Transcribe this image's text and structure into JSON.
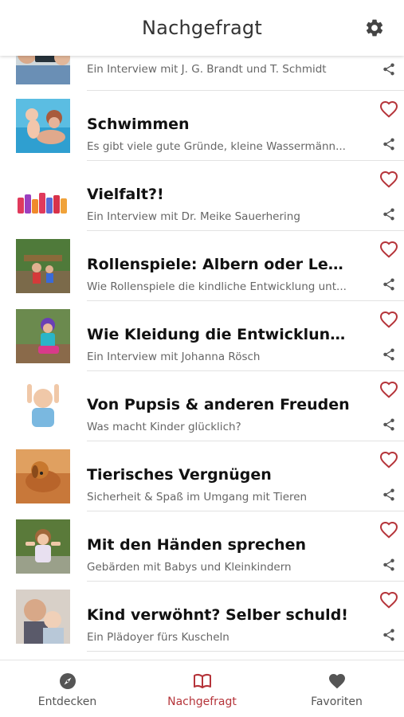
{
  "header": {
    "title": "Nachgefragt",
    "settings_icon": "gear-icon"
  },
  "colors": {
    "accent": "#b5343a",
    "icon_gray": "#555555"
  },
  "items": [
    {
      "title": "",
      "subtitle": "Ein Interview mit J. G. Brandt und T. Schmidt",
      "thumb": "reading-family"
    },
    {
      "title": "Schwimmen",
      "subtitle": "Es gibt viele gute Gründe, kleine Wassermänn...",
      "thumb": "swimming"
    },
    {
      "title": "Vielfalt?!",
      "subtitle": "Ein Interview mit Dr. Meike Sauerhering",
      "thumb": "colorful-figures"
    },
    {
      "title": "Rollenspiele: Albern oder Lernerfa...",
      "subtitle": "Wie Rollenspiele die kindliche Entwicklung unt...",
      "thumb": "playground"
    },
    {
      "title": "Wie Kleidung die Entwicklung unte...",
      "subtitle": "Ein Interview mit Johanna Rösch",
      "thumb": "costume-child"
    },
    {
      "title": "Von Pupsis & anderen Freuden",
      "subtitle": "Was macht Kinder glücklich?",
      "thumb": "happy-baby"
    },
    {
      "title": "Tierisches Vergnügen",
      "subtitle": "Sicherheit & Spaß im Umgang mit Tieren",
      "thumb": "dog"
    },
    {
      "title": "Mit den Händen sprechen",
      "subtitle": "Gebärden mit Babys und Kleinkindern",
      "thumb": "signing-girl"
    },
    {
      "title": "Kind verwöhnt? Selber schuld!",
      "subtitle": "Ein Plädoyer fürs Kuscheln",
      "thumb": "cuddling"
    }
  ],
  "nav": [
    {
      "label": "Entdecken",
      "icon": "compass-icon",
      "active": false
    },
    {
      "label": "Nachgefragt",
      "icon": "book-icon",
      "active": true
    },
    {
      "label": "Favoriten",
      "icon": "heart-icon",
      "active": false
    }
  ]
}
